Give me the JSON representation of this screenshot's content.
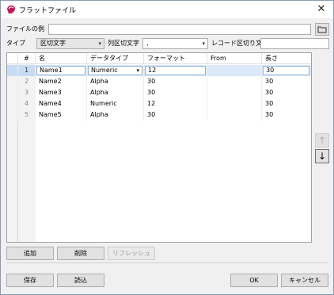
{
  "window": {
    "title": "フラットファイル",
    "close_icon": "✕"
  },
  "file_example": {
    "label": "ファイルの例",
    "value": ""
  },
  "type_row": {
    "type_label": "タイプ",
    "type_value": "区切文字",
    "col_sep_label": "列区切文字",
    "col_sep_value": ",",
    "rec_sep_label": "レコード区切り文字",
    "rec_sep_value": ""
  },
  "grid": {
    "headers": [
      "#",
      "名",
      "データタイプ",
      "フォーマット",
      "From",
      "長さ"
    ],
    "rows": [
      {
        "num": "1",
        "name": "Name1",
        "type": "Numeric",
        "format": "12",
        "from": "",
        "length": "30",
        "selected": true
      },
      {
        "num": "2",
        "name": "Name2",
        "type": "Alpha",
        "format": "30",
        "from": "",
        "length": "30",
        "selected": false
      },
      {
        "num": "3",
        "name": "Name3",
        "type": "Alpha",
        "format": "30",
        "from": "",
        "length": "30",
        "selected": false
      },
      {
        "num": "4",
        "name": "Name4",
        "type": "Numeric",
        "format": "12",
        "from": "",
        "length": "30",
        "selected": false
      },
      {
        "num": "5",
        "name": "Name5",
        "type": "Alpha",
        "format": "30",
        "from": "",
        "length": "30",
        "selected": false
      }
    ]
  },
  "side": {
    "up_icon": "↑",
    "down_icon": "↓"
  },
  "grid_buttons": {
    "add": "追加",
    "delete": "削除",
    "refresh": "リフレッシュ"
  },
  "footer": {
    "save": "保存",
    "load": "読込",
    "ok": "OK",
    "cancel": "キャンセル"
  },
  "colors": {
    "accent": "#c2185b",
    "selection": "#dbe9f8"
  }
}
